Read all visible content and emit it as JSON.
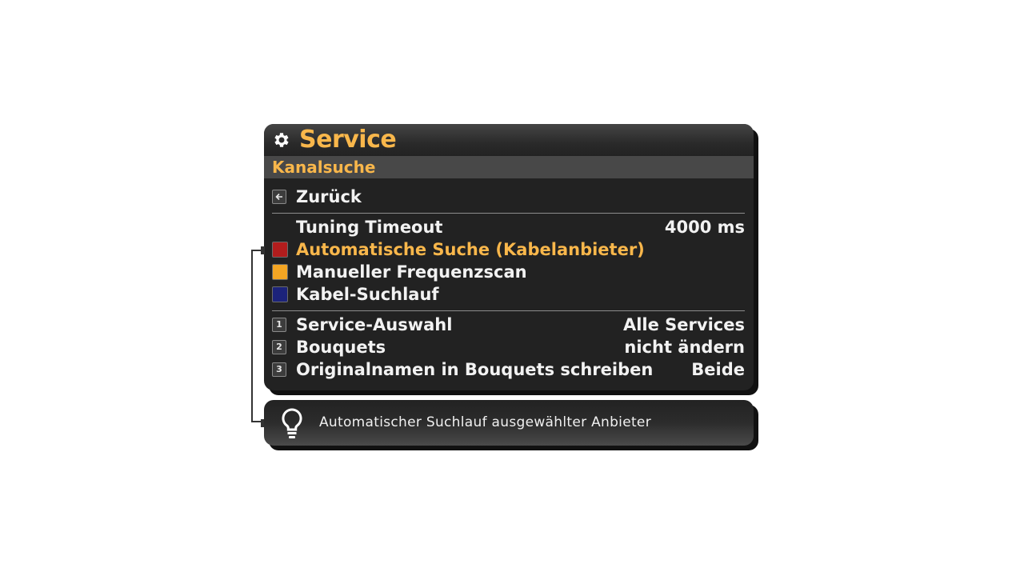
{
  "header": {
    "title": "Service",
    "subtitle": "Kanalsuche",
    "icon": "gear-icon"
  },
  "menu": {
    "back": {
      "label": "Zurück",
      "icon": "arrow-left-icon"
    },
    "tuning": {
      "label": "Tuning Timeout",
      "value": "4000 ms"
    },
    "items": [
      {
        "label": "Automatische Suche (Kabelanbieter)",
        "color": "#b21d1d",
        "selected": true
      },
      {
        "label": "Manueller Frequenzscan",
        "color": "#f5a623",
        "selected": false
      },
      {
        "label": "Kabel-Suchlauf",
        "color": "#1c237a",
        "selected": false
      }
    ],
    "options": [
      {
        "key": "1",
        "label": "Service-Auswahl",
        "value": "Alle Services"
      },
      {
        "key": "2",
        "label": "Bouquets",
        "value": "nicht ändern"
      },
      {
        "key": "3",
        "label": "Originalnamen in Bouquets schreiben",
        "value": "Beide"
      }
    ]
  },
  "hint": {
    "text": "Automatischer Suchlauf ausgewählter Anbieter",
    "icon": "lightbulb-icon"
  },
  "colors": {
    "accent": "#f9b74b",
    "panel": "#222222",
    "subheader": "#484848"
  }
}
